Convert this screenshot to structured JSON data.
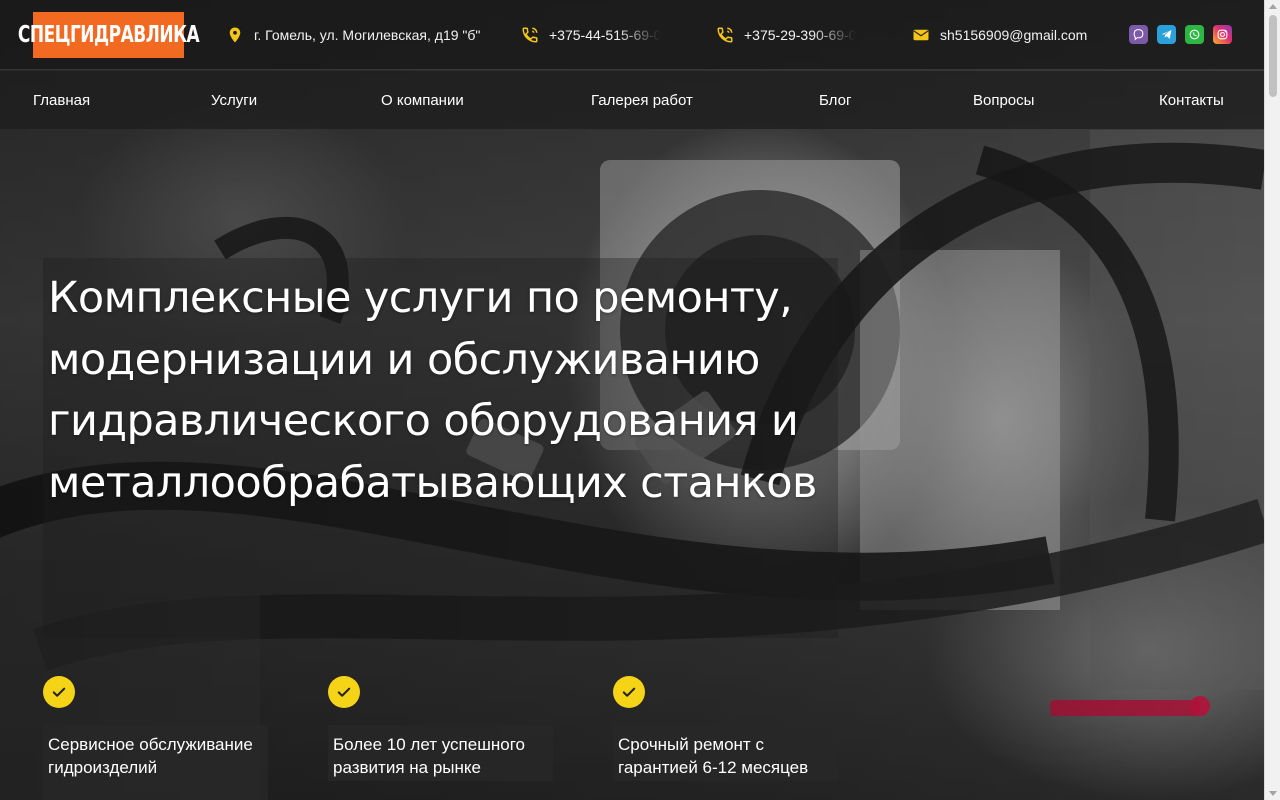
{
  "header": {
    "logo_text": "СПЕЦГИДРАВЛИКА",
    "address": "г. Гомель, ул. Могилевская, д19 \"б\"",
    "phone1": "+375-44-515-69-0",
    "phone2": "+375-29-390-69-0",
    "email": "sh5156909@gmail.com",
    "socials": [
      {
        "name": "viber-icon",
        "color": "#7d5aa8"
      },
      {
        "name": "telegram-icon",
        "color": "#2aa1da"
      },
      {
        "name": "whatsapp-icon",
        "color": "#2bb741"
      },
      {
        "name": "instagram-icon",
        "color": "#e1306c"
      }
    ]
  },
  "nav": {
    "items": [
      {
        "label": "Главная"
      },
      {
        "label": "Услуги"
      },
      {
        "label": "О компании"
      },
      {
        "label": "Галерея работ"
      },
      {
        "label": "Блог"
      },
      {
        "label": "Вопросы"
      },
      {
        "label": "Контакты"
      }
    ]
  },
  "hero": {
    "title": "Комплексные услуги по ремонту, модернизации и обслуживанию гидравлического оборудования и металлообрабатывающих станков"
  },
  "features": [
    {
      "text": "Сервисное обслуживание гидроизделий"
    },
    {
      "text": "Более 10 лет успешного развития на рынке"
    },
    {
      "text": "Срочный ремонт с гарантией 6-12 месяцев"
    }
  ],
  "colors": {
    "brand_orange": "#f26a21",
    "accent_yellow": "#f5d316",
    "icon_yellow": "#f5c518"
  }
}
